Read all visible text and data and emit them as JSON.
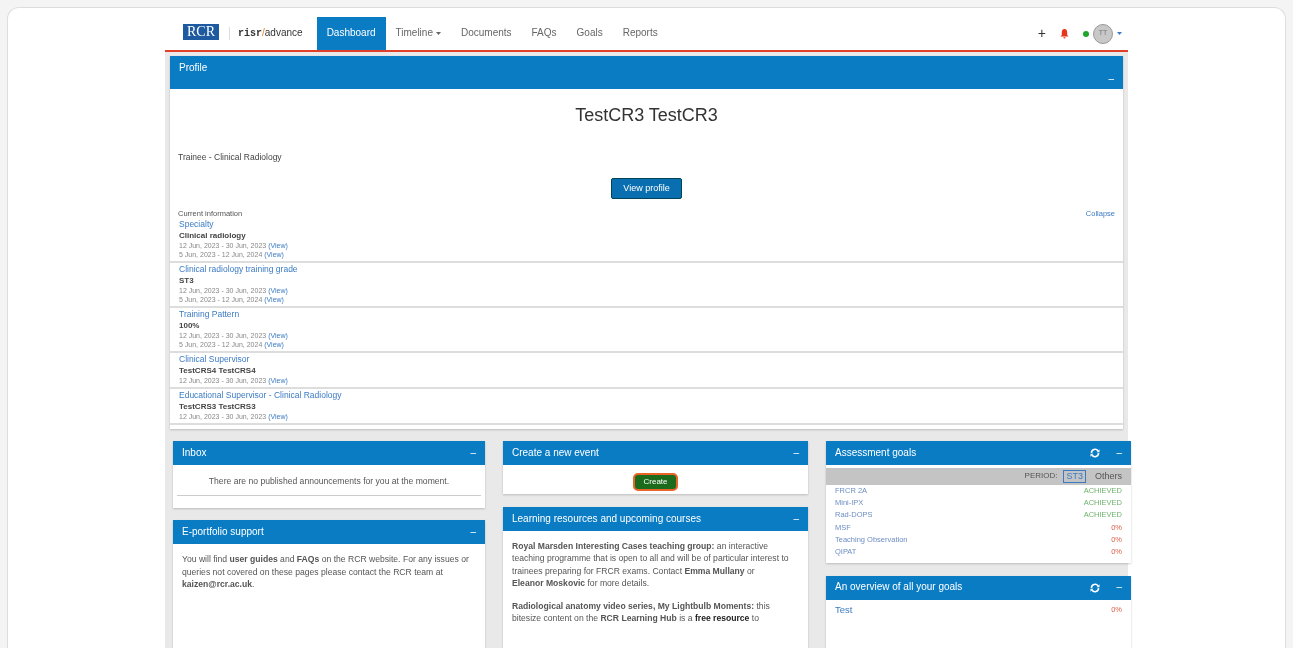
{
  "navbar": {
    "logo": "RCR",
    "brand": {
      "bold": "risr",
      "slash": "/",
      "rest": "advance"
    },
    "items": [
      {
        "label": "Dashboard",
        "selected": true,
        "caret": false
      },
      {
        "label": "Timeline",
        "selected": false,
        "caret": true
      },
      {
        "label": "Documents",
        "selected": false,
        "caret": false
      },
      {
        "label": "FAQs",
        "selected": false,
        "caret": false
      },
      {
        "label": "Goals",
        "selected": false,
        "caret": false
      },
      {
        "label": "Reports",
        "selected": false,
        "caret": false
      }
    ],
    "add": "+",
    "avatar": "TT"
  },
  "profile": {
    "title": "Profile",
    "toggle": "–",
    "name": "TestCR3 TestCR3",
    "role": "Trainee - Clinical Radiology",
    "button": "View profile",
    "section_label": "Current information",
    "collapse": "Collapse",
    "entries": [
      {
        "label": "Specialty",
        "value": "Clinical radiology",
        "periods": [
          {
            "dates": "12 Jun, 2023 - 30 Jun, 2023",
            "link": "(View)"
          },
          {
            "dates": "5 Jun, 2023 - 12 Jun, 2024",
            "link": "(View)"
          }
        ]
      },
      {
        "label": "Clinical radiology training grade",
        "value": "ST3",
        "periods": [
          {
            "dates": "12 Jun, 2023 - 30 Jun, 2023",
            "link": "(View)"
          },
          {
            "dates": "5 Jun, 2023 - 12 Jun, 2024",
            "link": "(View)"
          }
        ]
      },
      {
        "label": "Training Pattern",
        "value": "100%",
        "periods": [
          {
            "dates": "12 Jun, 2023 - 30 Jun, 2023",
            "link": "(View)"
          },
          {
            "dates": "5 Jun, 2023 - 12 Jun, 2024",
            "link": "(View)"
          }
        ]
      },
      {
        "label": "Clinical Supervisor",
        "value": "TestCRS4 TestCRS4",
        "periods": [
          {
            "dates": "12 Jun, 2023 - 30 Jun, 2023",
            "link": "(View)"
          }
        ]
      },
      {
        "label": "Educational Supervisor - Clinical Radiology",
        "value": "TestCRS3 TestCRS3",
        "periods": [
          {
            "dates": "12 Jun, 2023 - 30 Jun, 2023",
            "link": "(View)"
          }
        ]
      }
    ]
  },
  "inbox": {
    "title": "Inbox",
    "toggle": "–",
    "message": "There are no published announcements for you at the moment."
  },
  "support": {
    "title": "E-portfolio support",
    "toggle": "–",
    "paragraphs": [
      [
        {
          "kind": "plain",
          "text": "You will find "
        },
        {
          "kind": "link",
          "text": "user guides"
        },
        {
          "kind": "plain",
          "text": " and "
        },
        {
          "kind": "link",
          "text": "FAQs"
        },
        {
          "kind": "plain",
          "text": " on the RCR website. For any issues or queries not covered on these pages please contact the RCR team at "
        },
        {
          "kind": "link",
          "text": "kaizen@rcr.ac.uk"
        },
        {
          "kind": "plain",
          "text": "."
        }
      ]
    ]
  },
  "create_event": {
    "title": "Create a new event",
    "toggle": "–",
    "button": "Create"
  },
  "learning": {
    "title": "Learning resources and upcoming courses",
    "toggle": "–",
    "paragraphs": [
      [
        {
          "kind": "link",
          "text": "Royal Marsden Interesting Cases teaching group:"
        },
        {
          "kind": "plain",
          "text": " an interactive teaching programme that is open to all and will be of particular interest to trainees preparing for FRCR exams. Contact "
        },
        {
          "kind": "link",
          "text": "Emma Mullany"
        },
        {
          "kind": "plain",
          "text": " or "
        },
        {
          "kind": "link",
          "text": "Eleanor Moskovic"
        },
        {
          "kind": "plain",
          "text": " for more details."
        }
      ],
      [
        {
          "kind": "link",
          "text": "Radiological anatomy video series, My Lightbulb Moments:"
        },
        {
          "kind": "plain",
          "text": " this bitesize content on the "
        },
        {
          "kind": "link",
          "text": "RCR Learning Hub"
        },
        {
          "kind": "plain",
          "text": " is a "
        },
        {
          "kind": "bold",
          "text": "free resource"
        },
        {
          "kind": "plain",
          "text": " to"
        }
      ]
    ]
  },
  "assessment": {
    "title": "Assessment goals",
    "toggle": "–",
    "period_label": "PERIOD:",
    "periods": [
      {
        "label": "ST3",
        "selected": true
      },
      {
        "label": "Others",
        "selected": false
      }
    ],
    "goals": [
      {
        "name": "FRCR 2A",
        "status": "ACHIEVED",
        "kind": "achieved"
      },
      {
        "name": "Mini-IPX",
        "status": "ACHIEVED",
        "kind": "achieved"
      },
      {
        "name": "Rad-DOPS",
        "status": "ACHIEVED",
        "kind": "achieved"
      },
      {
        "name": "MSF",
        "status": "0%",
        "kind": "pending"
      },
      {
        "name": "Teaching Observation",
        "status": "0%",
        "kind": "pending"
      },
      {
        "name": "QIPAT",
        "status": "0%",
        "kind": "pending"
      }
    ]
  },
  "overview": {
    "title": "An overview of all your goals",
    "toggle": "–",
    "goals": [
      {
        "name": "Test",
        "status": "0%",
        "kind": "pending"
      }
    ]
  }
}
